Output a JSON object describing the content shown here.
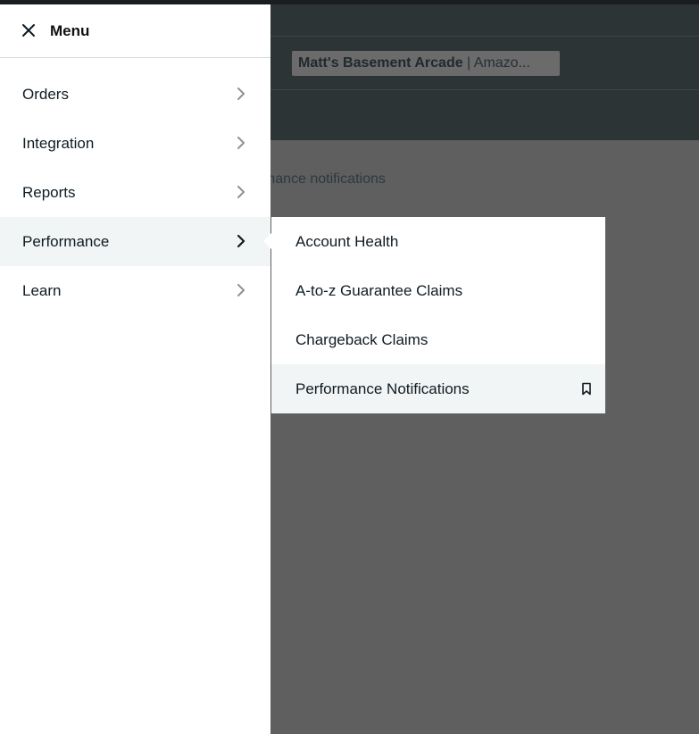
{
  "background": {
    "store_name": "Matt's Basement Arcade",
    "store_separator": " | ",
    "store_suffix": "Amazo...",
    "partial_link": "erformance notifications"
  },
  "menu": {
    "title": "Menu",
    "close_icon": "close-icon",
    "items": [
      {
        "label": "Orders",
        "icon": "chevron-right-icon"
      },
      {
        "label": "Integration",
        "icon": "chevron-right-icon"
      },
      {
        "label": "Reports",
        "icon": "chevron-right-icon"
      },
      {
        "label": "Performance",
        "icon": "chevron-right-icon",
        "active": true
      },
      {
        "label": "Learn",
        "icon": "chevron-right-icon"
      }
    ]
  },
  "submenu": {
    "parent": "Performance",
    "items": [
      {
        "label": "Account Health"
      },
      {
        "label": "A-to-z Guarantee Claims"
      },
      {
        "label": "Chargeback Claims"
      },
      {
        "label": "Performance Notifications",
        "active": true,
        "icon": "bookmark-icon"
      }
    ]
  },
  "colors": {
    "overlay": "#5f5f5f",
    "header_dark": "#2d3436",
    "menu_bg": "#ffffff",
    "active_bg": "#f2f5f5",
    "text": "#0f1b23"
  }
}
